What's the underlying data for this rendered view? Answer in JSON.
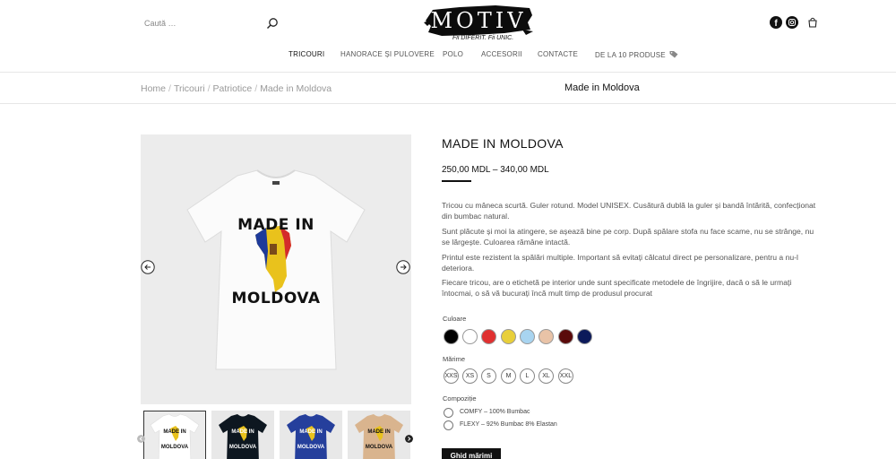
{
  "header": {
    "search_placeholder": "Caută …",
    "logo_text": "MOTIV",
    "tagline": "Fii DIFERIT. Fii UNIC."
  },
  "nav": {
    "items": [
      {
        "label": "TRICOURI"
      },
      {
        "label": "HANORACE ȘI PULOVERE"
      },
      {
        "label": "POLO"
      },
      {
        "label": "ACCESORII"
      },
      {
        "label": "CONTACTE"
      },
      {
        "label": "DE LA 10 PRODUSE"
      }
    ]
  },
  "breadcrumb": {
    "items": [
      "Home",
      "Tricouri",
      "Patriotice",
      "Made in Moldova"
    ],
    "title": "Made in Moldova"
  },
  "product": {
    "title": "MADE IN MOLDOVA",
    "price": "250,00 MDL – 340,00 MDL",
    "print_top": "MADE IN",
    "print_bottom": "MOLDOVA",
    "description": [
      "Tricou cu mâneca scurtă. Guler rotund. Model UNISEX. Cusătură dublă la guler și bandă întărită, confecționat din bumbac natural.",
      "Sunt plăcute și moi la atingere, se așează bine pe corp. După spălare stofa nu face scame, nu se strânge, nu se lărgește. Culoarea rămâne intactă.",
      "Printul este rezistent la spălări multiple. Important să evitați călcatul direct pe personalizare, pentru a nu-l deteriora.",
      "Fiecare tricou, are o etichetă pe interior unde sunt specificate metodele de îngrijire, dacă o să le urmați întocmai, o să vă bucurați încă mult timp de produsul procurat"
    ],
    "color_label": "Culoare",
    "colors": [
      "#000000",
      "#ffffff",
      "#e03030",
      "#e8cf3a",
      "#a8d4f0",
      "#e9c3a7",
      "#5a0a0a",
      "#0c1a5a"
    ],
    "size_label": "Mărime",
    "sizes": [
      "XXS",
      "XS",
      "S",
      "M",
      "L",
      "XL",
      "XXL"
    ],
    "composition_label": "Compoziție",
    "compositions": [
      "COMFY – 100% Bumbac",
      "FLEXY – 92% Bumbac 8% Elastan"
    ],
    "guide_button": "Ghid mărimi"
  },
  "thumbnails": [
    {
      "shirt_color": "#ffffff",
      "bg": "#ececec"
    },
    {
      "shirt_color": "#0d1720",
      "bg": "#e8e8e8"
    },
    {
      "shirt_color": "#253f9c",
      "bg": "#e8e8e8"
    },
    {
      "shirt_color": "#d9b48e",
      "bg": "#e8e8e8"
    }
  ]
}
